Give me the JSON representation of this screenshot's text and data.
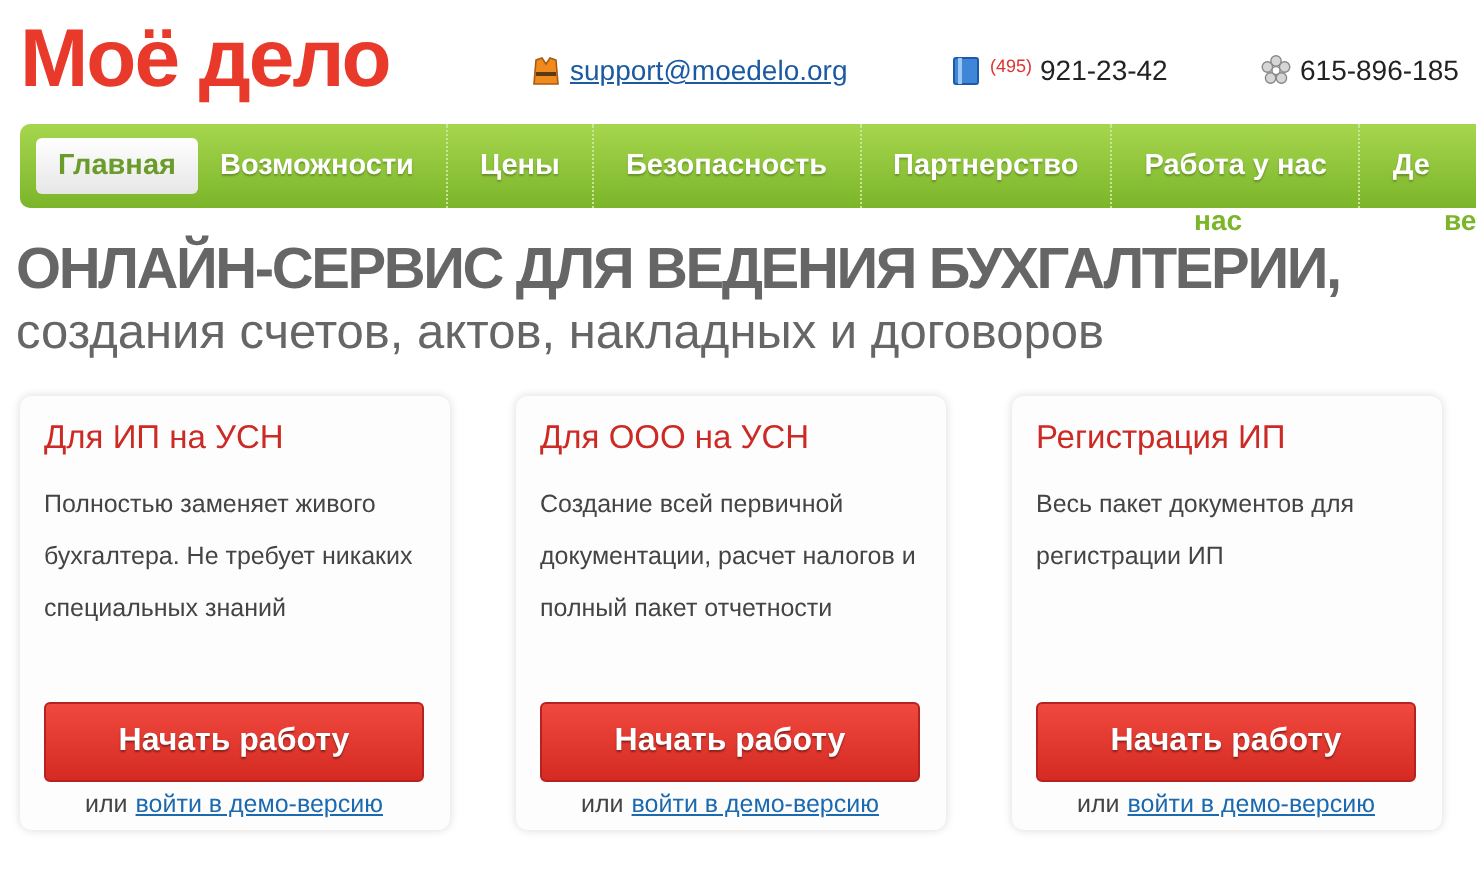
{
  "logo": "Моё дело",
  "contacts": [
    {
      "kind": "email",
      "text": "support@moedelo.org"
    },
    {
      "kind": "phone",
      "code": "(495)",
      "text": "921-23-42"
    },
    {
      "kind": "icq",
      "text": "615-896-185"
    }
  ],
  "nav": [
    {
      "label": "Главная",
      "selected": true
    },
    {
      "label": "Возможности",
      "selected": false
    },
    {
      "label": "Цены",
      "selected": false
    },
    {
      "label": "Безопасность",
      "selected": false
    },
    {
      "label": "Партнерство",
      "selected": false
    },
    {
      "label": "Работа у нас",
      "selected": false
    },
    {
      "label": "Де",
      "selected": false
    }
  ],
  "nav_overflow": [
    "нас",
    "ве"
  ],
  "headline": "ОНЛАЙН-СЕРВИС ДЛЯ ВЕДЕНИЯ БУХГАЛТЕРИИ,",
  "subheadline": "создания счетов, актов, накладных и договоров",
  "cards": [
    {
      "title": "Для ИП на УСН",
      "text": "Полностью заменяет живого бухгалтера. Не требует никаких специальных знаний",
      "button": "Начать работу",
      "or": "или",
      "link": "войти в демо-версию"
    },
    {
      "title": "Для ООО на УСН",
      "text": "Создание всей первичной документации, расчет налогов и полный пакет отчетности",
      "button": "Начать работу",
      "or": "или",
      "link": "войти в демо-версию"
    },
    {
      "title": "Регистрация ИП",
      "text": "Весь пакет документов для регистрации ИП",
      "button": "Начать работу",
      "or": "или",
      "link": "войти в демо-версию"
    }
  ]
}
